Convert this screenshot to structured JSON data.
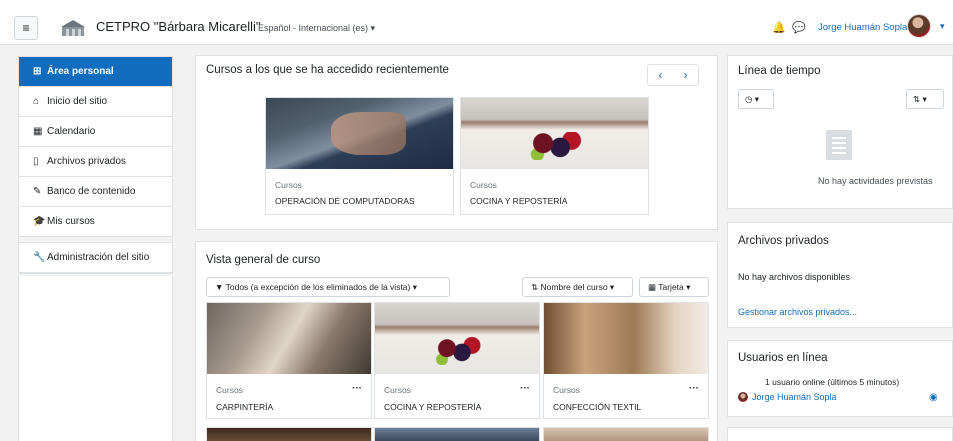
{
  "header": {
    "site_name": "CETPRO \"Bárbara Micarelli\"",
    "language": "Español - Internacional (es) ▾",
    "user_name": "Jorge Huamán Sopla",
    "menu_icon": "hamburger-icon",
    "notification_icon": "bell-icon",
    "messages_icon": "chat-icon"
  },
  "sidebar": {
    "items": [
      {
        "label": "Área personal",
        "icon": "dashboard-icon"
      },
      {
        "label": "Inicio del sitio",
        "icon": "home-icon"
      },
      {
        "label": "Calendario",
        "icon": "calendar-icon"
      },
      {
        "label": "Archivos privados",
        "icon": "file-icon"
      },
      {
        "label": "Banco de contenido",
        "icon": "brush-icon"
      },
      {
        "label": "Mis cursos",
        "icon": "graduation-cap-icon"
      },
      {
        "label": "Administración del sitio",
        "icon": "wrench-icon"
      }
    ]
  },
  "recent": {
    "title": "Cursos a los que se ha accedido recientemente",
    "courses": [
      {
        "category": "Cursos",
        "name": "OPERACIÓN DE COMPUTADORAS"
      },
      {
        "category": "Cursos",
        "name": "COCINA Y REPOSTERÍA"
      }
    ]
  },
  "overview": {
    "title": "Vista general de curso",
    "filter_label": "Todos (a excepción de los eliminados de la vista) ▾",
    "sort_label": "Nombre del curso ▾",
    "view_label": "Tarjeta ▾",
    "more_label": "···",
    "courses": [
      {
        "category": "Cursos",
        "name": "CARPINTERÍA"
      },
      {
        "category": "Cursos",
        "name": "COCINA Y REPOSTERÍA"
      },
      {
        "category": "Cursos",
        "name": "CONFECCIÓN TEXTIL"
      }
    ]
  },
  "timeline": {
    "title": "Línea de tiempo",
    "empty_text": "No hay actividades previstas"
  },
  "files": {
    "title": "Archivos privados",
    "empty_text": "No hay archivos disponibles",
    "manage_link": "Gestionar archivos privados..."
  },
  "online": {
    "title": "Usuarios en línea",
    "summary": "1 usuario online (últimos 5 minutos)",
    "user": "Jorge Huamán Sopla"
  }
}
